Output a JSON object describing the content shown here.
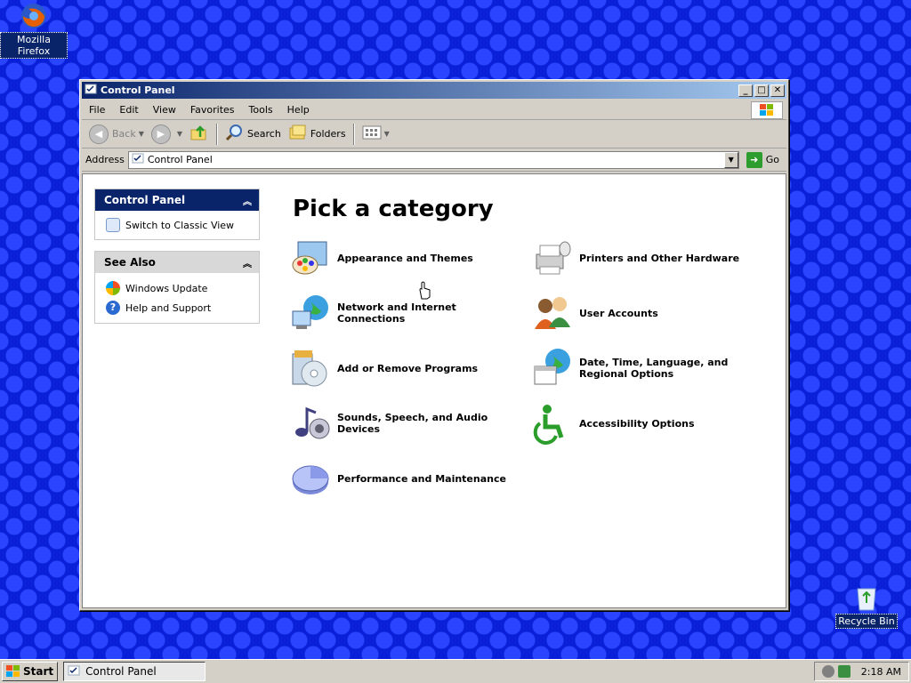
{
  "desktop": {
    "firefox_label": "Mozilla Firefox",
    "recycle_label": "Recycle Bin"
  },
  "window": {
    "title": "Control Panel",
    "menu": [
      "File",
      "Edit",
      "View",
      "Favorites",
      "Tools",
      "Help"
    ],
    "toolbar": {
      "back": "Back",
      "search": "Search",
      "folders": "Folders"
    },
    "address": {
      "label": "Address",
      "value": "Control Panel",
      "go": "Go"
    }
  },
  "sidebar": {
    "control_panel_title": "Control Panel",
    "switch_view": "Switch to Classic View",
    "see_also_title": "See Also",
    "see_also": [
      "Windows Update",
      "Help and Support"
    ]
  },
  "main": {
    "heading": "Pick a category",
    "categories": [
      "Appearance and Themes",
      "Printers and Other Hardware",
      "Network and Internet Connections",
      "User Accounts",
      "Add or Remove Programs",
      "Date, Time, Language, and Regional Options",
      "Sounds, Speech, and Audio Devices",
      "Accessibility Options",
      "Performance and Maintenance"
    ]
  },
  "taskbar": {
    "start": "Start",
    "task": "Control Panel",
    "clock": "2:18 AM"
  }
}
